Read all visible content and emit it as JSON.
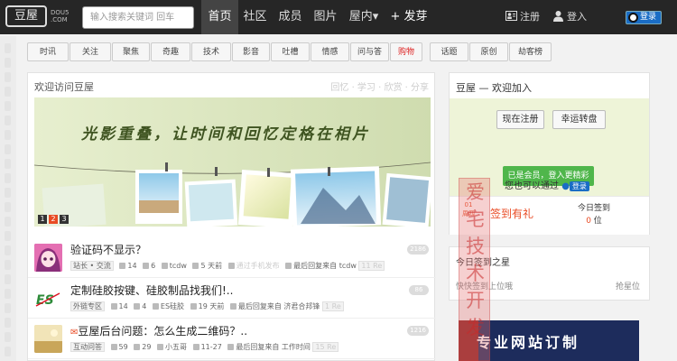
{
  "header": {
    "logo_text": "豆屋",
    "logo_sub": "DOU5 .COM",
    "search_placeholder": "输入搜索关键词 回车",
    "nav": [
      "首页",
      "社区",
      "成员",
      "图片",
      "屋内▾",
      "+ 发芽"
    ],
    "register": "注册",
    "login": "登入",
    "qq_login": "登录"
  },
  "categories": [
    "时讯",
    "关注",
    "聚焦",
    "奇趣",
    "技术",
    "影音",
    "吐槽",
    "情感",
    "问与答",
    "购物",
    "话题",
    "原创",
    "劫客榜"
  ],
  "main": {
    "title": "欢迎访问豆屋",
    "tags": "回忆 · 学习 · 欣赏 · 分享",
    "banner_text": "光影重叠，让时间和回忆定格在相片",
    "banner_pages": [
      "1",
      "2",
      "3"
    ],
    "posts": [
      {
        "title": "验证码不显示？",
        "meta": [
          "站长 • 交流",
          "14",
          "6",
          "tcdw",
          "5 天前",
          "通过手机发布",
          "最后回复来自 tcdw",
          "11 Re"
        ],
        "count": "2186"
      },
      {
        "title": "定制硅胶按键、硅胶制品找我们!..",
        "meta": [
          "外链专区",
          "14",
          "4",
          "ES硅胶",
          "19 天前",
          "最后回复来自 济君合邦锋",
          "1 Re"
        ],
        "count": "86"
      },
      {
        "title": "豆屋后台问题：怎么生成二维码？..",
        "meta": [
          "互动问答",
          "59",
          "29",
          "小五哥",
          "11-27",
          "最后回复来自 工作时间",
          "15 Re"
        ],
        "count": "1216"
      }
    ]
  },
  "sidebar": {
    "title": "豆屋 — 欢迎加入",
    "register_btn": "现在注册",
    "lucky_btn": "幸运转盘",
    "login_btn": "已是会员，登入更精彩",
    "also_login": "您也可以通过",
    "qq_btn": "登录",
    "checkin_date_line1": "01",
    "checkin_date_line2": "周四",
    "checkin_label": "签到有礼",
    "today_label": "今日签到",
    "today_count": "0",
    "today_unit": "位",
    "star_title": "今日签到之星",
    "star_sub": "快快签到上位哦",
    "star_right": "抢星位",
    "ad_text": "专业网站订制"
  },
  "stamp_text": "爱宅技术开发",
  "colors": {
    "topbar": "#262626",
    "accent_orange": "#e94b24",
    "green": "#4fb64b",
    "qq_blue": "#1a6dc5"
  }
}
